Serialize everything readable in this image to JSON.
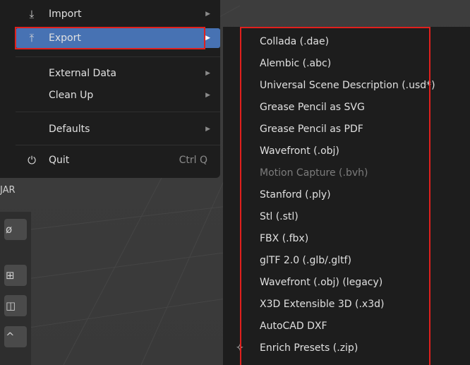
{
  "file_menu": {
    "items": [
      {
        "icon": "import-icon",
        "label": "Import",
        "has_submenu": true
      },
      {
        "icon": "export-icon",
        "label": "Export",
        "has_submenu": true,
        "active": true
      },
      {
        "label": "External Data",
        "has_submenu": true
      },
      {
        "label": "Clean Up",
        "has_submenu": true
      },
      {
        "label": "Defaults",
        "has_submenu": true
      },
      {
        "icon": "power-icon",
        "label": "Quit",
        "shortcut": "Ctrl Q"
      }
    ]
  },
  "sidebar": {
    "label": "JAR"
  },
  "export_submenu": {
    "items": [
      {
        "label": "Collada (.dae)"
      },
      {
        "label": "Alembic (.abc)"
      },
      {
        "label": "Universal Scene Description (.usd*)"
      },
      {
        "label": "Grease Pencil as SVG"
      },
      {
        "label": "Grease Pencil as PDF"
      },
      {
        "label": "Wavefront (.obj)"
      },
      {
        "label": "Motion Capture (.bvh)",
        "disabled": true
      },
      {
        "label": "Stanford (.ply)"
      },
      {
        "label": "Stl (.stl)"
      },
      {
        "label": "FBX (.fbx)"
      },
      {
        "label": "glTF 2.0 (.glb/.gltf)"
      },
      {
        "label": "Wavefront (.obj) (legacy)"
      },
      {
        "label": "X3D Extensible 3D (.x3d)"
      },
      {
        "label": "AutoCAD DXF"
      },
      {
        "icon": "sparkle-icon",
        "label": "Enrich Presets (.zip)"
      }
    ]
  },
  "colors": {
    "menu_bg": "#1d1d1d",
    "highlight": "#4772b3",
    "annotation": "#e0201d"
  }
}
